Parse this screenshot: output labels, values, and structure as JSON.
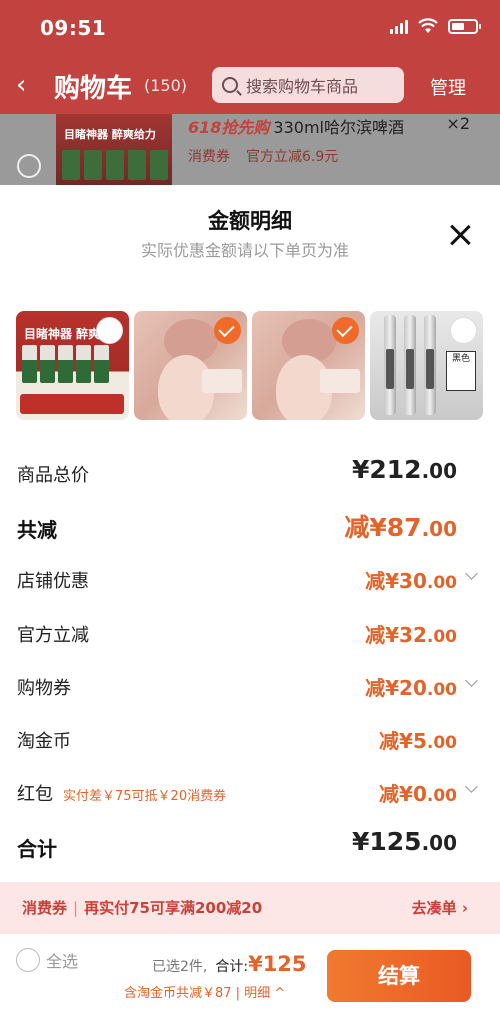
{
  "status": {
    "time": "09:51"
  },
  "nav": {
    "back": "‹",
    "title": "购物车",
    "count": "(150)",
    "search_placeholder": "搜索购物车商品",
    "manage": "管理"
  },
  "bg_item": {
    "promo_tag": "618抢先购",
    "title": "330ml哈尔滨啤酒",
    "qty": "×2",
    "thumb_text": "目睹神器 醉爽给力",
    "coupon_label": "消费券",
    "discount": "官方立减6.9元"
  },
  "sheet": {
    "title": "金额明细",
    "subtitle": "实际优惠金额请以下单页为准",
    "thumbnails": [
      {
        "name": "beer",
        "selected": false,
        "caption": "目睹神器 醉爽"
      },
      {
        "name": "cushion-a",
        "selected": true,
        "caption": ""
      },
      {
        "name": "cushion-b",
        "selected": true,
        "caption": ""
      },
      {
        "name": "pens",
        "selected": false,
        "caption": "黑色"
      }
    ],
    "rows": [
      {
        "label": "商品总价",
        "prefix": "",
        "amount": "¥212",
        "dec": ".00"
      },
      {
        "label": "共减",
        "prefix": "减",
        "amount": "¥87",
        "dec": ".00"
      },
      {
        "label": "店铺优惠",
        "prefix": "减",
        "amount": "¥30",
        "dec": ".00"
      },
      {
        "label": "官方立减",
        "prefix": "减",
        "amount": "¥32",
        "dec": ".00"
      },
      {
        "label": "购物券",
        "prefix": "减",
        "amount": "¥20",
        "dec": ".00"
      },
      {
        "label": "淘金币",
        "prefix": "减",
        "amount": "¥5",
        "dec": ".00"
      },
      {
        "label": "红包",
        "note": "实付差￥75可抵￥20消费券",
        "prefix": "减",
        "amount": "¥0",
        "dec": ".00"
      },
      {
        "label": "合计",
        "prefix": "",
        "amount": "¥125",
        "dec": ".00"
      }
    ]
  },
  "promo": {
    "tag": "消费券",
    "text": "再实付75可享满200减20",
    "action": "去凑单 ›"
  },
  "footer": {
    "select_all": "全选",
    "selected": "已选2件,",
    "total_label": "合计:",
    "total": "¥125",
    "detail": "含淘金币共减￥87 | 明细 ^",
    "checkout": "结算"
  },
  "colors": {
    "accent": "#e3642a",
    "nav_bg": "#c2423f",
    "promo_bg": "#fde7e6"
  }
}
